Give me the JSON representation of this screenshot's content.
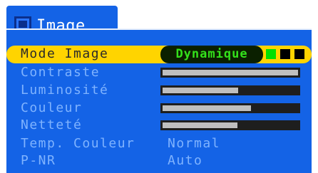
{
  "tab": {
    "title": "Image",
    "icon": "picture-frame-icon"
  },
  "menu": {
    "mode_image": {
      "label": "Mode Image",
      "value": "Dynamique",
      "indicator": [
        "#00e000",
        "#000000",
        "#000000"
      ]
    },
    "contraste": {
      "label": "Contraste",
      "level": 1.0
    },
    "luminosite": {
      "label": "Luminosité",
      "level": 0.56
    },
    "couleur": {
      "label": "Couleur",
      "level": 0.65
    },
    "nettete": {
      "label": "Netteté",
      "level": 0.55
    },
    "temp_couleur": {
      "label": "Temp. Couleur",
      "value": "Normal"
    },
    "pnr": {
      "label": "P-NR",
      "value": "Auto"
    }
  },
  "colors": {
    "panel": "#1463e6",
    "label": "#7fb3ff",
    "highlight": "#ffd400",
    "value_text": "#34e21b",
    "bar_fill": "#bfbfbf",
    "bar_track": "#1e1e1e"
  }
}
